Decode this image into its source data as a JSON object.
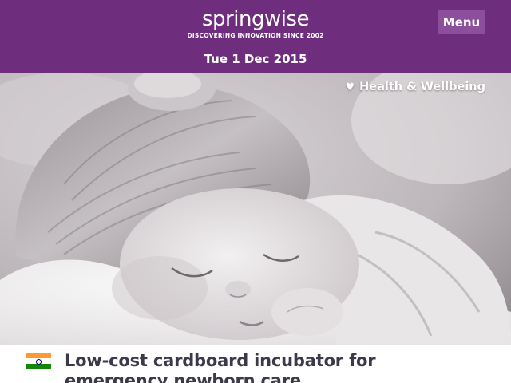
{
  "header": {
    "logo_text": "springwise",
    "tagline": "DISCOVERING INNOVATION SINCE 2002",
    "menu_label": "Menu",
    "date": "Tue 1 Dec 2015"
  },
  "hero": {
    "category_label": "Health & Wellbeing",
    "category_icon": "heart-icon"
  },
  "article": {
    "flag": "India",
    "title": "Low-cost cardboard incubator for emergency newborn care"
  },
  "colors": {
    "brand_purple": "#6e2e7d",
    "menu_button": "#8c4f9b",
    "title_text": "#3a3a4a"
  }
}
